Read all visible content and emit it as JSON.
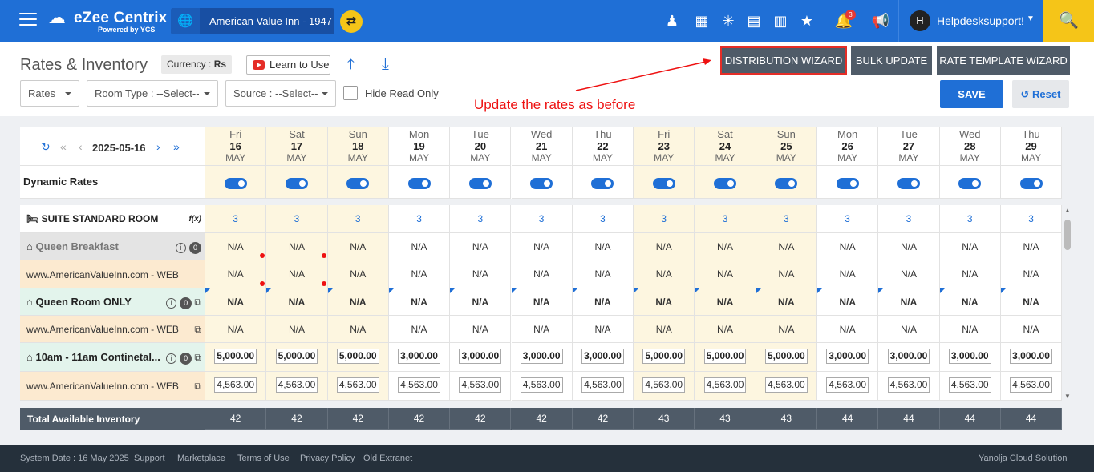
{
  "header": {
    "logo_title": "eZee Centrix",
    "logo_sub": "Powered by YCS",
    "hotel_name": "American Value Inn -  1947",
    "notifications_count": "3",
    "avatar_letter": "H",
    "user_name": "Helpdesksupport!",
    "icons": [
      "staff-icon",
      "calendar-clock-icon",
      "network-icon",
      "clipboard-icon",
      "chart-icon",
      "star-icon",
      "bell-icon",
      "megaphone-icon",
      "search-icon"
    ]
  },
  "toolbar": {
    "title": "Rates & Inventory",
    "currency_label": "Currency : ",
    "currency_value": "Rs",
    "learn_label": "Learn to Use",
    "distribution_wizard": "DISTRIBUTION WIZARD",
    "bulk_update": "BULK UPDATE",
    "rate_template_wizard": "RATE TEMPLATE WIZARD",
    "filter_rates": "Rates",
    "filter_room_type": "Room Type :  --Select--",
    "filter_source": "Source :  --Select--",
    "hide_read_only": "Hide Read Only",
    "save": "SAVE",
    "reset": "Reset"
  },
  "annotation": "Update the rates as before",
  "grid": {
    "current_date": "2025-05-16",
    "dynamic_rates_label": "Dynamic Rates",
    "days": [
      {
        "name": "Fri",
        "day": "16",
        "month": "MAY",
        "weekend": true
      },
      {
        "name": "Sat",
        "day": "17",
        "month": "MAY",
        "weekend": true
      },
      {
        "name": "Sun",
        "day": "18",
        "month": "MAY",
        "weekend": true
      },
      {
        "name": "Mon",
        "day": "19",
        "month": "MAY",
        "weekend": false
      },
      {
        "name": "Tue",
        "day": "20",
        "month": "MAY",
        "weekend": false
      },
      {
        "name": "Wed",
        "day": "21",
        "month": "MAY",
        "weekend": false
      },
      {
        "name": "Thu",
        "day": "22",
        "month": "MAY",
        "weekend": false
      },
      {
        "name": "Fri",
        "day": "23",
        "month": "MAY",
        "weekend": true
      },
      {
        "name": "Sat",
        "day": "24",
        "month": "MAY",
        "weekend": true
      },
      {
        "name": "Sun",
        "day": "25",
        "month": "MAY",
        "weekend": true
      },
      {
        "name": "Mon",
        "day": "26",
        "month": "MAY",
        "weekend": false
      },
      {
        "name": "Tue",
        "day": "27",
        "month": "MAY",
        "weekend": false
      },
      {
        "name": "Wed",
        "day": "28",
        "month": "MAY",
        "weekend": false
      },
      {
        "name": "Thu",
        "day": "29",
        "month": "MAY",
        "weekend": false
      }
    ],
    "room_name": "SUITE STANDARD ROOM",
    "fx_label": "f(x)",
    "room_inventory": [
      "3",
      "3",
      "3",
      "3",
      "3",
      "3",
      "3",
      "3",
      "3",
      "3",
      "3",
      "3",
      "3",
      "3"
    ],
    "rows": [
      {
        "label": "Queen Breakfast",
        "kind": "plan-gray",
        "badge": "0",
        "values": [
          "N/A",
          "N/A",
          "N/A",
          "N/A",
          "N/A",
          "N/A",
          "N/A",
          "N/A",
          "N/A",
          "N/A",
          "N/A",
          "N/A",
          "N/A",
          "N/A"
        ]
      },
      {
        "label": "www.AmericanValueInn.com - WEB",
        "kind": "source",
        "values": [
          "N/A",
          "N/A",
          "N/A",
          "N/A",
          "N/A",
          "N/A",
          "N/A",
          "N/A",
          "N/A",
          "N/A",
          "N/A",
          "N/A",
          "N/A",
          "N/A"
        ]
      },
      {
        "label": "Queen Room ONLY",
        "kind": "plan-green",
        "badge": "0",
        "values": [
          "N/A",
          "N/A",
          "N/A",
          "N/A",
          "N/A",
          "N/A",
          "N/A",
          "N/A",
          "N/A",
          "N/A",
          "N/A",
          "N/A",
          "N/A",
          "N/A"
        ]
      },
      {
        "label": "www.AmericanValueInn.com - WEB",
        "kind": "source-copy",
        "values": [
          "N/A",
          "N/A",
          "N/A",
          "N/A",
          "N/A",
          "N/A",
          "N/A",
          "N/A",
          "N/A",
          "N/A",
          "N/A",
          "N/A",
          "N/A",
          "N/A"
        ]
      },
      {
        "label": "10am - 11am Continetal...",
        "kind": "plan-green-input",
        "badge": "0",
        "values": [
          "5,000.00",
          "5,000.00",
          "5,000.00",
          "3,000.00",
          "3,000.00",
          "3,000.00",
          "3,000.00",
          "5,000.00",
          "5,000.00",
          "5,000.00",
          "3,000.00",
          "3,000.00",
          "3,000.00",
          "3,000.00"
        ]
      },
      {
        "label": "www.AmericanValueInn.com - WEB",
        "kind": "source-input",
        "values": [
          "4,563.00",
          "4,563.00",
          "4,563.00",
          "4,563.00",
          "4,563.00",
          "4,563.00",
          "4,563.00",
          "4,563.00",
          "4,563.00",
          "4,563.00",
          "4,563.00",
          "4,563.00",
          "4,563.00",
          "4,563.00"
        ]
      }
    ],
    "total_label": "Total Available Inventory",
    "totals": [
      "42",
      "42",
      "42",
      "42",
      "42",
      "42",
      "42",
      "43",
      "43",
      "43",
      "44",
      "44",
      "44",
      "44"
    ]
  },
  "footer": {
    "system_date": "System Date : 16 May 2025",
    "support": "Support",
    "marketplace": "Marketplace",
    "terms": "Terms of Use",
    "privacy": "Privacy Policy",
    "old_extranet": "Old Extranet",
    "company": "Yanolja Cloud Solution"
  },
  "colors": {
    "primary": "#1f6fd6",
    "accent": "#f5c518",
    "weekend": "#fdf6e0",
    "annotation": "#e11111"
  }
}
